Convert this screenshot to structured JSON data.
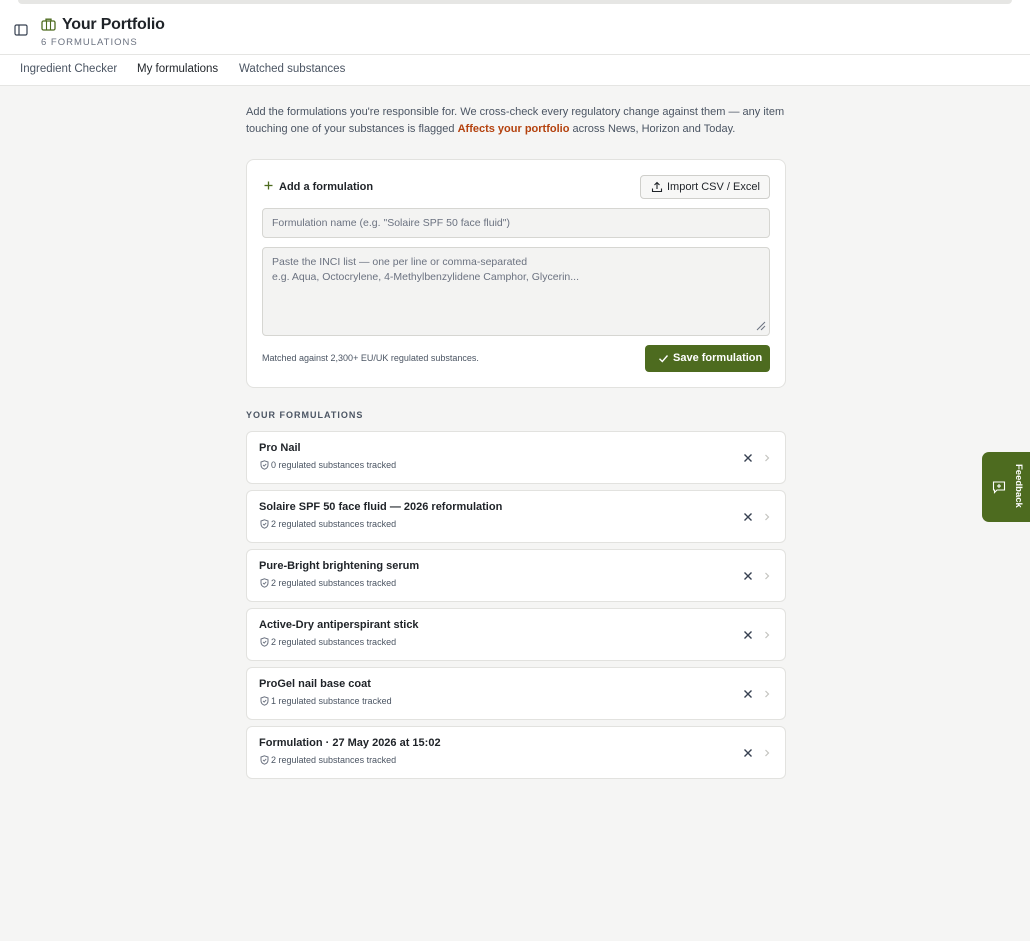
{
  "header": {
    "title": "Your Portfolio",
    "subtitle": "6 FORMULATIONS"
  },
  "tabs": [
    {
      "label": "Ingredient Checker",
      "active": false
    },
    {
      "label": "My formulations",
      "active": true
    },
    {
      "label": "Watched substances",
      "active": false
    }
  ],
  "intro": {
    "text_before": "Add the formulations you're responsible for. We cross-check every regulatory change against them — any item touching one of your substances is flagged ",
    "highlight": "Affects your portfolio",
    "text_after": " across News, Horizon and Today."
  },
  "add_form": {
    "title": "Add a formulation",
    "import_label": "Import CSV / Excel",
    "name_placeholder": "Formulation name (e.g. \"Solaire SPF 50 face fluid\")",
    "name_value": "",
    "inci_placeholder": "Paste the INCI list — one per line or comma-separated\ne.g. Aqua, Octocrylene, 4-Methylbenzylidene Camphor, Glycerin...",
    "inci_value": "",
    "matched_note": "Matched against 2,300+ EU/UK regulated substances.",
    "save_label": "Save formulation"
  },
  "formulations": {
    "section_title": "YOUR FORMULATIONS",
    "items": [
      {
        "name": "Pro Nail",
        "meta": "0 regulated substances tracked"
      },
      {
        "name": "Solaire SPF 50 face fluid — 2026 reformulation",
        "meta": "2 regulated substances tracked"
      },
      {
        "name": "Pure-Bright brightening serum",
        "meta": "2 regulated substances tracked"
      },
      {
        "name": "Active-Dry antiperspirant stick",
        "meta": "2 regulated substances tracked"
      },
      {
        "name": "ProGel nail base coat",
        "meta": "1 regulated substance tracked"
      },
      {
        "name": "Formulation · 27 May 2026 at 15:02",
        "meta": "2 regulated substances tracked"
      }
    ]
  },
  "feedback": {
    "label": "Feedback"
  },
  "icons": {
    "sidebar_toggle": "sidebar-toggle-icon",
    "brand": "briefcase-icon",
    "add": "plus-icon",
    "import": "upload-icon",
    "save": "check-icon",
    "row_status": "shield-icon",
    "row_remove": "close-icon",
    "row_open": "chevron-right-icon",
    "feedback": "message-plus-icon"
  },
  "colors": {
    "accent": "#4d6b1f",
    "highlight": "#b4420e",
    "background": "#f5f5f4"
  }
}
